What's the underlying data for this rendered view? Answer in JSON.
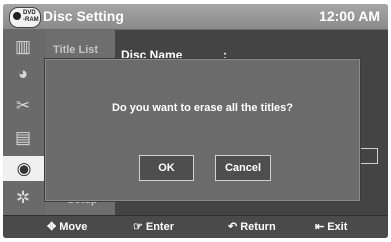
{
  "header": {
    "badge_line1": "DVD",
    "badge_line2": "-RAM",
    "title": "Disc Setting",
    "time": "12:00 AM"
  },
  "sidebar": {
    "icons": [
      "film-icon",
      "disc-lock-icon",
      "scissors-icon",
      "playlist-icon",
      "disc-setting-icon",
      "gear-icon"
    ],
    "active_icon": "disc-setting-icon"
  },
  "menu": {
    "items": [
      "Title List",
      "Setup"
    ]
  },
  "content": {
    "field_label": "Disc Name",
    "separator": ":"
  },
  "dialog": {
    "message": "Do you want to erase all the titles?",
    "ok_label": "OK",
    "cancel_label": "Cancel"
  },
  "footer": {
    "move": "Move",
    "enter": "Enter",
    "return": "Return",
    "exit": "Exit"
  },
  "colors": {
    "screen_bg": "#555555",
    "title_bar": "#9a9a9a",
    "dialog_bg": "#6b6b6b",
    "active_item": "#f0f0f0"
  }
}
